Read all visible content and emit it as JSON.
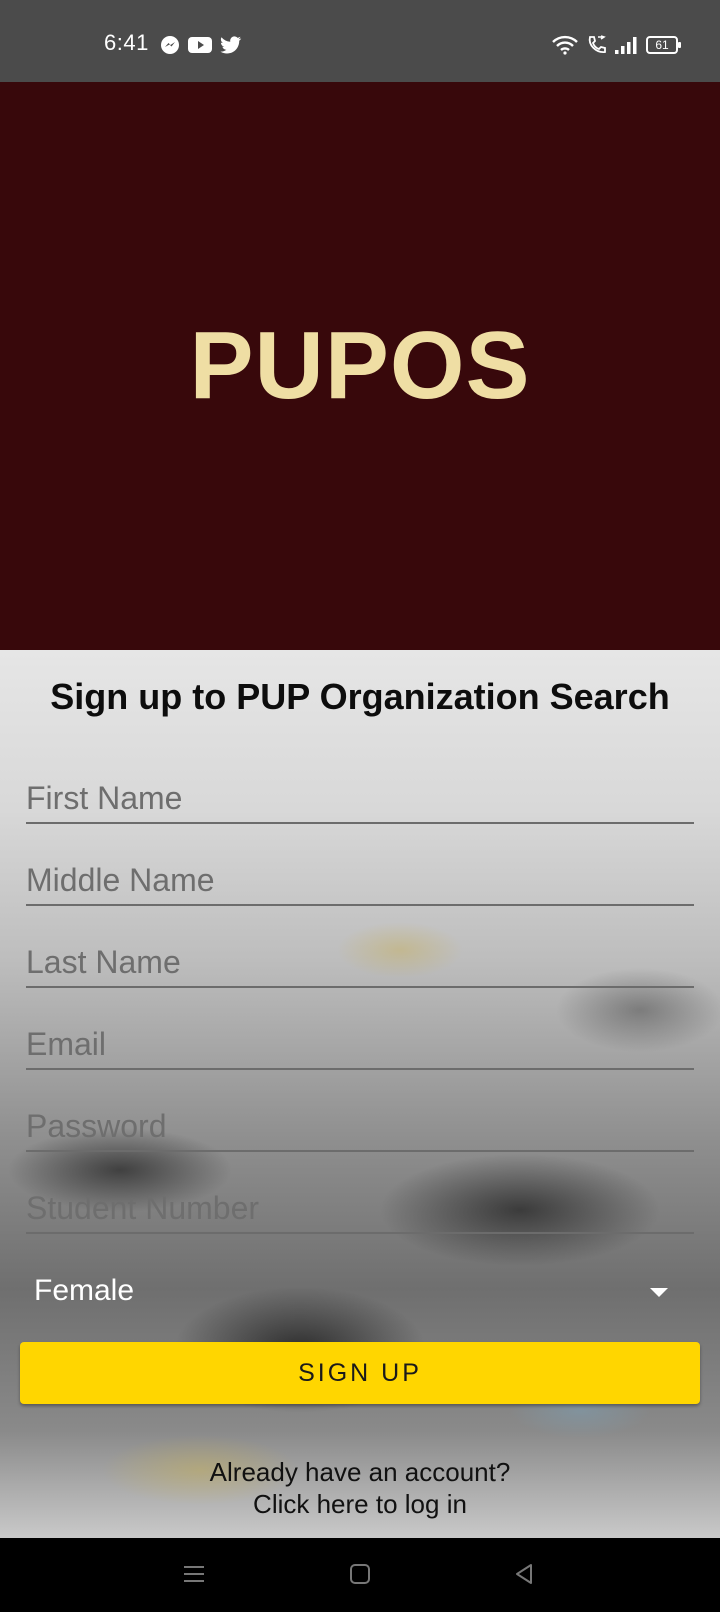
{
  "status_bar": {
    "time": "6:41",
    "app_icons": [
      "messenger-icon",
      "youtube-icon",
      "twitter-icon"
    ],
    "system_icons": [
      "wifi-icon",
      "call-icon",
      "signal-icon",
      "battery-icon"
    ],
    "battery_level": "61"
  },
  "header": {
    "brand": "PUPOS",
    "background_color": "#38080b",
    "brand_color": "#efdea4"
  },
  "form": {
    "title": "Sign up to PUP Organization Search",
    "fields": {
      "first_name": "First Name",
      "middle_name": "Middle Name",
      "last_name": "Last Name",
      "email": "Email",
      "password": "Password",
      "student_number": "Student Number"
    },
    "gender": "Female",
    "signup_label": "SIGN UP",
    "signup_color": "#ffd600",
    "login_prompt_line1": "Already have an account?",
    "login_prompt_line2": "Click here to log in"
  },
  "nav_bar": {
    "icons": [
      "menu-icon",
      "home-icon",
      "back-icon"
    ]
  }
}
